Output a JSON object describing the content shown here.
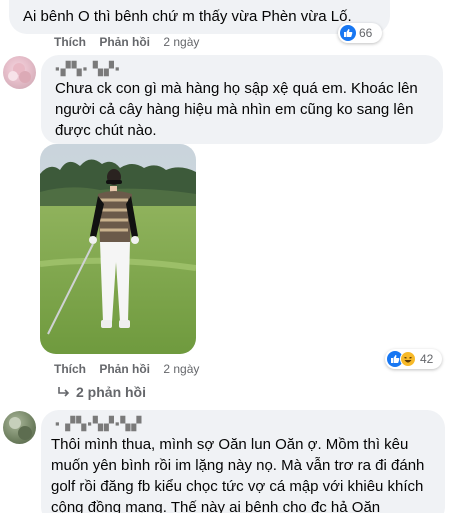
{
  "comment1": {
    "text": "Ai bênh O thì bênh chứ m thấy vừa Phèn vừa Lố.",
    "like": "Thích",
    "reply": "Phản hồi",
    "time": "2 ngày",
    "reaction_count": "66"
  },
  "comment2": {
    "author": "▪︎▞▚▪︎ ▚▞▪",
    "text": "Chưa ck con gì mà hàng họ sập xệ quá em. Khoác lên người cả cây hàng hiệu mà nhìn em cũng ko sang lên được chút nào.",
    "like": "Thích",
    "reply": "Phản hồi",
    "time": "2 ngày",
    "reaction_count": "42",
    "replies_link": "2 phản hồi"
  },
  "comment3": {
    "author": "▪︎ ▞▚▪︎▚▞▪▚▞",
    "text": "Thôi mình thua, mình sợ Oăn lun Oăn ợ. Mồm thì kêu muốn yên bình rồi im lặng này nọ. Mà vẫn trơ ra đi đánh golf rồi đăng fb kiểu chọc tức vợ cá mập với khiêu khích cộng đồng mạng. Thế này ai bênh cho đc hả Oăn"
  },
  "colors": {
    "bubble": "#f0f2f5",
    "like_blue": "#1877f2",
    "haha_yellow": "#f7b928",
    "meta_gray": "#65676b"
  }
}
